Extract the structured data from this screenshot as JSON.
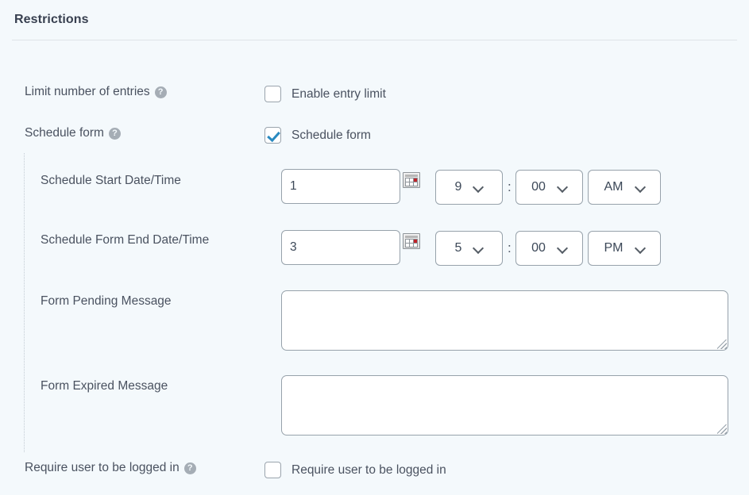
{
  "section": {
    "title": "Restrictions"
  },
  "rows": {
    "limit_entries": {
      "label": "Limit number of entries",
      "help_glyph": "?",
      "checkbox_label": "Enable entry limit",
      "checked": false
    },
    "schedule_form": {
      "label": "Schedule form",
      "help_glyph": "?",
      "checkbox_label": "Schedule form",
      "checked": true
    },
    "schedule_start": {
      "label": "Schedule Start Date/Time",
      "date_value": "1",
      "date_placeholder": "",
      "hour": "9",
      "separator": ":",
      "minute": "00",
      "meridiem": "AM",
      "calendar_icon": "calendar-icon"
    },
    "schedule_end": {
      "label": "Schedule Form End Date/Time",
      "date_value": "3",
      "date_placeholder": "",
      "hour": "5",
      "separator": ":",
      "minute": "00",
      "meridiem": "PM",
      "calendar_icon": "calendar-icon"
    },
    "pending_message": {
      "label": "Form Pending Message",
      "value": "",
      "placeholder": ""
    },
    "expired_message": {
      "label": "Form Expired Message",
      "value": "",
      "placeholder": ""
    },
    "require_login": {
      "label": "Require user to be logged in",
      "help_glyph": "?",
      "checkbox_label": "Require user to be logged in",
      "checked": false
    }
  },
  "colors": {
    "page_background": "#f4f9fc",
    "text": "#4a5260",
    "checkbox_accent": "#2a8ac0",
    "border": "#97a2ab",
    "rule": "#dfe3e8",
    "help_icon_background": "#a5adb5"
  }
}
